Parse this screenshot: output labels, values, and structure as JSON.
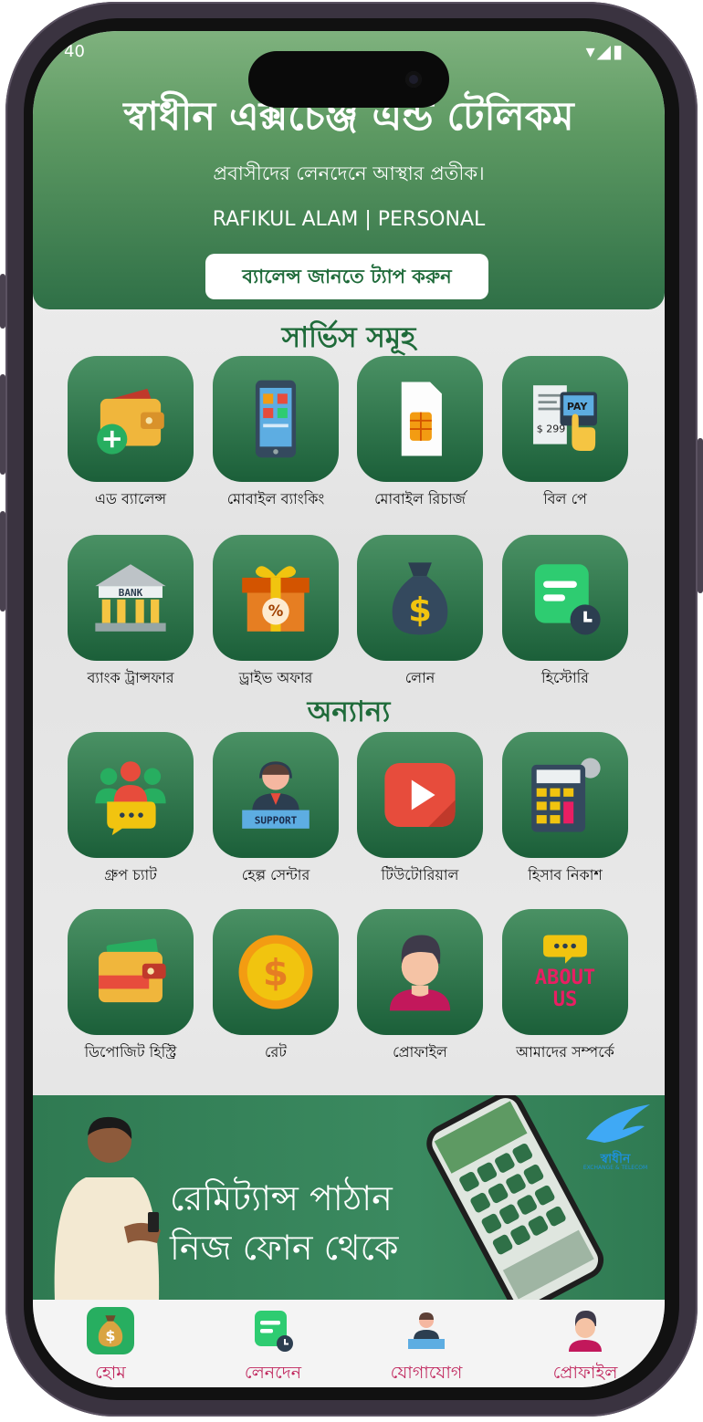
{
  "status": {
    "time": "40",
    "icons": "▾◢▮"
  },
  "header": {
    "title": "স্বাধীন এক্সচেঞ্জ এন্ড টেলিকম",
    "tagline": "প্রবাসীদের লেনদেনে আস্থার প্রতীক।",
    "user": "RAFIKUL ALAM | PERSONAL",
    "balance_button": "ব্যালেন্স জানতে ট্যাপ করুন"
  },
  "sections": {
    "services": "সার্ভিস সমূহ",
    "others": "অন্যান্য"
  },
  "services": [
    {
      "label": "এড ব্যালেন্স",
      "icon": "wallet-add-icon"
    },
    {
      "label": "মোবাইল ব্যাংকিং",
      "icon": "mobile-phone-icon"
    },
    {
      "label": "মোবাইল রিচার্জ",
      "icon": "sim-card-icon"
    },
    {
      "label": "বিল পে",
      "icon": "bill-pay-icon"
    },
    {
      "label": "ব্যাংক ট্রান্সফার",
      "icon": "bank-icon"
    },
    {
      "label": "ড্রাইভ অফার",
      "icon": "gift-box-icon"
    },
    {
      "label": "লোন",
      "icon": "money-bag-icon"
    },
    {
      "label": "হিস্টোরি",
      "icon": "history-icon"
    }
  ],
  "others": [
    {
      "label": "গ্রুপ চ্যাট",
      "icon": "group-chat-icon"
    },
    {
      "label": "হেল্প সেন্টার",
      "icon": "support-agent-icon"
    },
    {
      "label": "টিউটোরিয়াল",
      "icon": "play-video-icon"
    },
    {
      "label": "হিসাব নিকাশ",
      "icon": "calculator-icon"
    },
    {
      "label": "ডিপোজিট হিস্ট্রি",
      "icon": "deposit-wallet-icon"
    },
    {
      "label": "রেট",
      "icon": "dollar-coin-icon"
    },
    {
      "label": "প্রোফাইল",
      "icon": "profile-icon"
    },
    {
      "label": "আমাদের সম্পর্কে",
      "icon": "about-us-icon"
    }
  ],
  "icon_texts": {
    "bank": "BANK",
    "pay": "PAY",
    "support": "SUPPORT",
    "about_1": "ABOUT",
    "about_2": "US",
    "bill_amount": "$ 299"
  },
  "banner": {
    "line1": "রেমিট্যান্স পাঠান",
    "line2": "নিজ ফোন থেকে",
    "logo_text": "স্বাধীন",
    "logo_sub": "EXCHANGE & TELECOM"
  },
  "nav": [
    {
      "label": "হোম",
      "icon": "money-bag-icon"
    },
    {
      "label": "লেনদেন",
      "icon": "history-icon"
    },
    {
      "label": "যোগাযোগ",
      "icon": "support-agent-icon"
    },
    {
      "label": "প্রোফাইল",
      "icon": "profile-icon"
    }
  ],
  "colors": {
    "primary": "#1f6b3a",
    "header_top": "#7fb27e",
    "nav_text": "#c0265d"
  }
}
